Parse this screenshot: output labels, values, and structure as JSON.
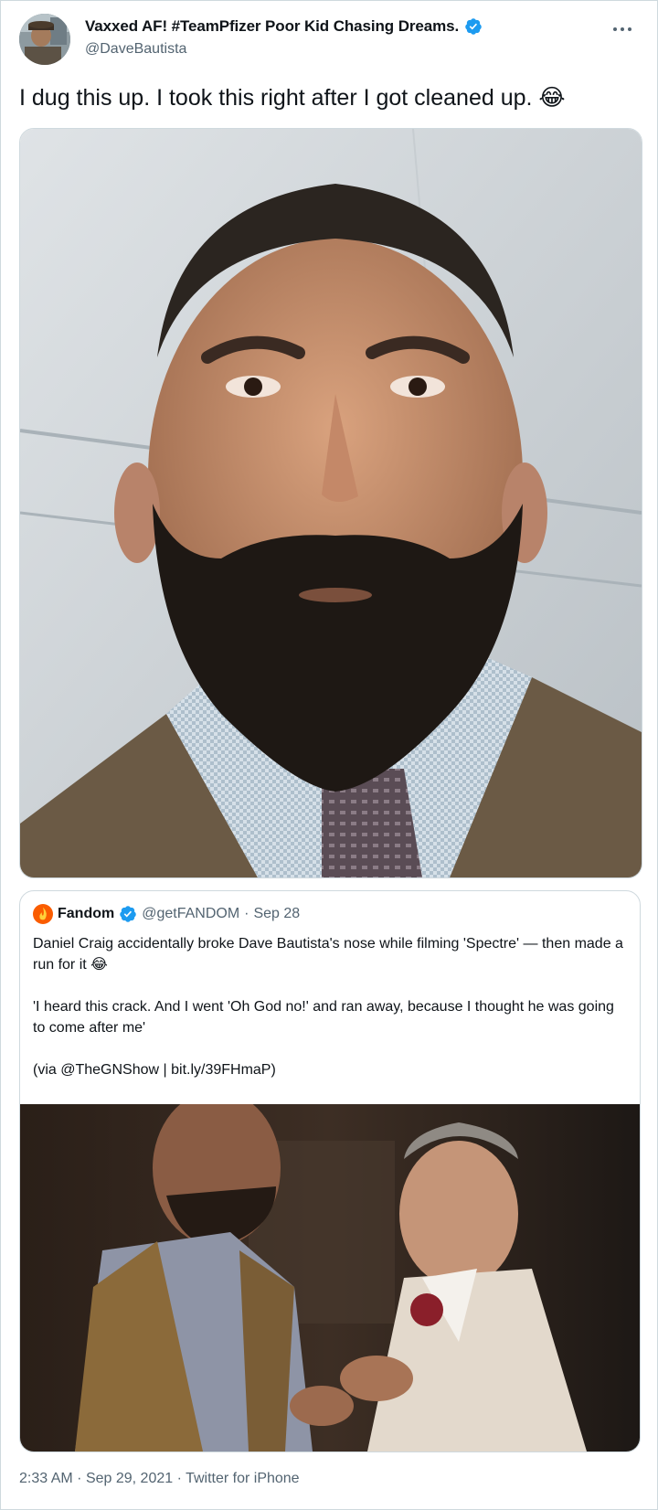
{
  "tweet": {
    "author": {
      "display_name": "Vaxxed AF! #TeamPfizer Poor Kid Chasing Dreams.",
      "handle": "@DaveBautista",
      "verified": true,
      "avatar": "profile-photo"
    },
    "text": "I dug this up. I took this right after I got cleaned up. 😂",
    "media": {
      "alt": "selfie-photo"
    },
    "quoted_tweet": {
      "author": {
        "display_name": "Fandom",
        "handle": "@getFANDOM",
        "verified": true,
        "logo": "fandom-flame-icon"
      },
      "separator": "·",
      "date": "Sep 28",
      "paragraphs": [
        "Daniel Craig accidentally broke Dave Bautista's nose while filming 'Spectre' — then made a run for it 😂",
        "'I heard this crack. And I went 'Oh God no!' and ran away, because I thought he was going to come after me'",
        "(via @TheGNShow | bit.ly/39FHmaP)"
      ],
      "media": {
        "alt": "movie-still-photo"
      }
    },
    "meta": {
      "time": "2:33 AM",
      "separator": "·",
      "date": "Sep 29, 2021",
      "source": "Twitter for iPhone"
    }
  },
  "icons": {
    "verified": "verified-badge-icon",
    "more": "more-options-icon"
  },
  "colors": {
    "verified_blue": "#1d9bf0",
    "secondary_text": "#536471",
    "border": "#cfd9de",
    "fandom_orange": "#fa5c00"
  }
}
